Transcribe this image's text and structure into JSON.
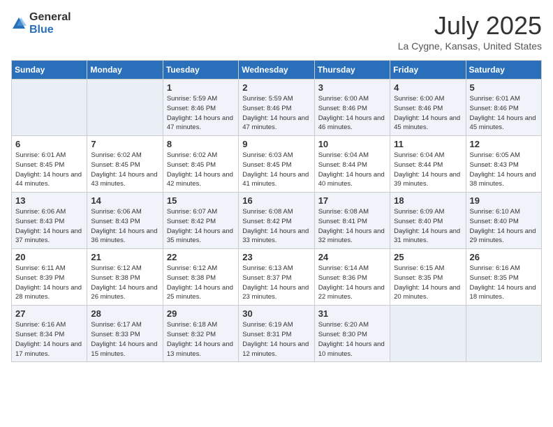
{
  "header": {
    "logo_general": "General",
    "logo_blue": "Blue",
    "month": "July 2025",
    "location": "La Cygne, Kansas, United States"
  },
  "weekdays": [
    "Sunday",
    "Monday",
    "Tuesday",
    "Wednesday",
    "Thursday",
    "Friday",
    "Saturday"
  ],
  "weeks": [
    [
      {
        "day": "",
        "info": ""
      },
      {
        "day": "",
        "info": ""
      },
      {
        "day": "1",
        "info": "Sunrise: 5:59 AM\nSunset: 8:46 PM\nDaylight: 14 hours and 47 minutes."
      },
      {
        "day": "2",
        "info": "Sunrise: 5:59 AM\nSunset: 8:46 PM\nDaylight: 14 hours and 47 minutes."
      },
      {
        "day": "3",
        "info": "Sunrise: 6:00 AM\nSunset: 8:46 PM\nDaylight: 14 hours and 46 minutes."
      },
      {
        "day": "4",
        "info": "Sunrise: 6:00 AM\nSunset: 8:46 PM\nDaylight: 14 hours and 45 minutes."
      },
      {
        "day": "5",
        "info": "Sunrise: 6:01 AM\nSunset: 8:46 PM\nDaylight: 14 hours and 45 minutes."
      }
    ],
    [
      {
        "day": "6",
        "info": "Sunrise: 6:01 AM\nSunset: 8:45 PM\nDaylight: 14 hours and 44 minutes."
      },
      {
        "day": "7",
        "info": "Sunrise: 6:02 AM\nSunset: 8:45 PM\nDaylight: 14 hours and 43 minutes."
      },
      {
        "day": "8",
        "info": "Sunrise: 6:02 AM\nSunset: 8:45 PM\nDaylight: 14 hours and 42 minutes."
      },
      {
        "day": "9",
        "info": "Sunrise: 6:03 AM\nSunset: 8:45 PM\nDaylight: 14 hours and 41 minutes."
      },
      {
        "day": "10",
        "info": "Sunrise: 6:04 AM\nSunset: 8:44 PM\nDaylight: 14 hours and 40 minutes."
      },
      {
        "day": "11",
        "info": "Sunrise: 6:04 AM\nSunset: 8:44 PM\nDaylight: 14 hours and 39 minutes."
      },
      {
        "day": "12",
        "info": "Sunrise: 6:05 AM\nSunset: 8:43 PM\nDaylight: 14 hours and 38 minutes."
      }
    ],
    [
      {
        "day": "13",
        "info": "Sunrise: 6:06 AM\nSunset: 8:43 PM\nDaylight: 14 hours and 37 minutes."
      },
      {
        "day": "14",
        "info": "Sunrise: 6:06 AM\nSunset: 8:43 PM\nDaylight: 14 hours and 36 minutes."
      },
      {
        "day": "15",
        "info": "Sunrise: 6:07 AM\nSunset: 8:42 PM\nDaylight: 14 hours and 35 minutes."
      },
      {
        "day": "16",
        "info": "Sunrise: 6:08 AM\nSunset: 8:42 PM\nDaylight: 14 hours and 33 minutes."
      },
      {
        "day": "17",
        "info": "Sunrise: 6:08 AM\nSunset: 8:41 PM\nDaylight: 14 hours and 32 minutes."
      },
      {
        "day": "18",
        "info": "Sunrise: 6:09 AM\nSunset: 8:40 PM\nDaylight: 14 hours and 31 minutes."
      },
      {
        "day": "19",
        "info": "Sunrise: 6:10 AM\nSunset: 8:40 PM\nDaylight: 14 hours and 29 minutes."
      }
    ],
    [
      {
        "day": "20",
        "info": "Sunrise: 6:11 AM\nSunset: 8:39 PM\nDaylight: 14 hours and 28 minutes."
      },
      {
        "day": "21",
        "info": "Sunrise: 6:12 AM\nSunset: 8:38 PM\nDaylight: 14 hours and 26 minutes."
      },
      {
        "day": "22",
        "info": "Sunrise: 6:12 AM\nSunset: 8:38 PM\nDaylight: 14 hours and 25 minutes."
      },
      {
        "day": "23",
        "info": "Sunrise: 6:13 AM\nSunset: 8:37 PM\nDaylight: 14 hours and 23 minutes."
      },
      {
        "day": "24",
        "info": "Sunrise: 6:14 AM\nSunset: 8:36 PM\nDaylight: 14 hours and 22 minutes."
      },
      {
        "day": "25",
        "info": "Sunrise: 6:15 AM\nSunset: 8:35 PM\nDaylight: 14 hours and 20 minutes."
      },
      {
        "day": "26",
        "info": "Sunrise: 6:16 AM\nSunset: 8:35 PM\nDaylight: 14 hours and 18 minutes."
      }
    ],
    [
      {
        "day": "27",
        "info": "Sunrise: 6:16 AM\nSunset: 8:34 PM\nDaylight: 14 hours and 17 minutes."
      },
      {
        "day": "28",
        "info": "Sunrise: 6:17 AM\nSunset: 8:33 PM\nDaylight: 14 hours and 15 minutes."
      },
      {
        "day": "29",
        "info": "Sunrise: 6:18 AM\nSunset: 8:32 PM\nDaylight: 14 hours and 13 minutes."
      },
      {
        "day": "30",
        "info": "Sunrise: 6:19 AM\nSunset: 8:31 PM\nDaylight: 14 hours and 12 minutes."
      },
      {
        "day": "31",
        "info": "Sunrise: 6:20 AM\nSunset: 8:30 PM\nDaylight: 14 hours and 10 minutes."
      },
      {
        "day": "",
        "info": ""
      },
      {
        "day": "",
        "info": ""
      }
    ]
  ]
}
